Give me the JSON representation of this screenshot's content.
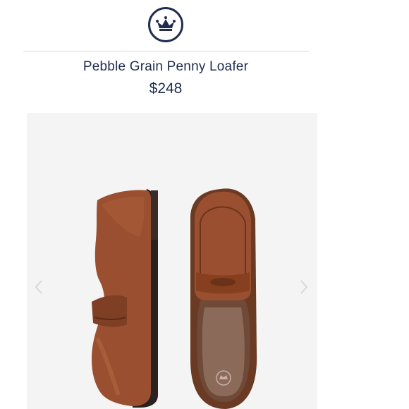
{
  "brand": {
    "logo_icon": "crown-circle-logo",
    "color": "#1f2d4f"
  },
  "product": {
    "title": "Pebble Grain Penny Loafer",
    "price": "$248"
  },
  "gallery": {
    "image": "brown-penny-loafer-pair",
    "prev_icon": "chevron-left-icon",
    "next_icon": "chevron-right-icon",
    "shoe_color": "#9a5030",
    "sole_color": "#2a2120"
  }
}
